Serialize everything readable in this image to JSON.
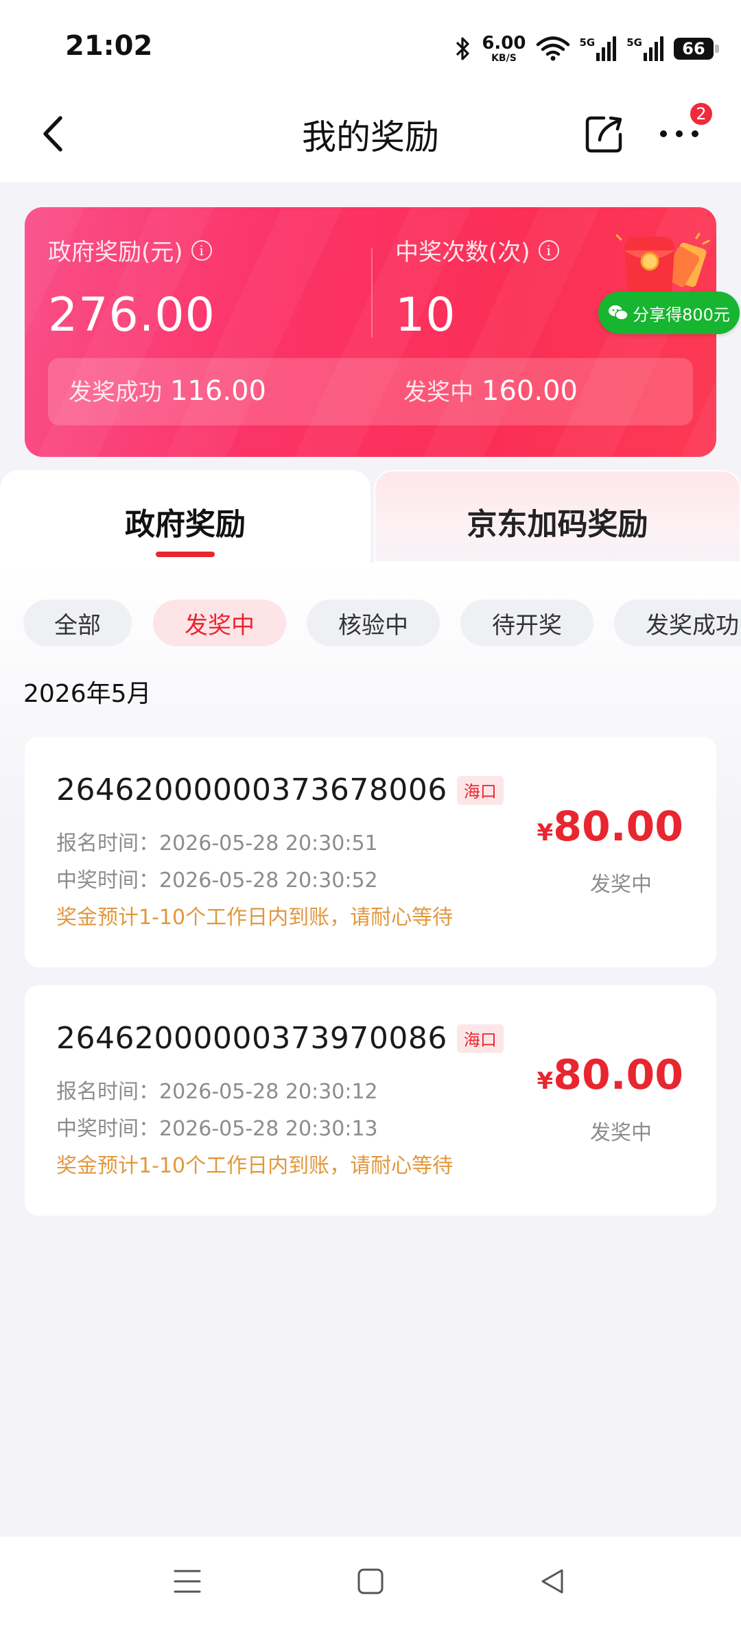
{
  "status_bar": {
    "time": "21:02",
    "net_speed": "6.00",
    "net_unit": "KB/S",
    "signal_1": "5G",
    "signal_2": "5G",
    "battery": "66"
  },
  "header": {
    "title": "我的奖励",
    "notification_count": "2"
  },
  "summary": {
    "gov_reward_label": "政府奖励(元)",
    "gov_reward_value": "276.00",
    "win_count_label": "中奖次数(次)",
    "win_count_value": "10",
    "paid_label": "发奖成功",
    "paid_value": "116.00",
    "pending_label": "发奖中",
    "pending_value": "160.00",
    "share_label": "分享得800元"
  },
  "tabs": [
    {
      "label": "政府奖励",
      "active": true
    },
    {
      "label": "京东加码奖励",
      "active": false
    }
  ],
  "filters": [
    {
      "label": "全部",
      "active": false
    },
    {
      "label": "发奖中",
      "active": true
    },
    {
      "label": "核验中",
      "active": false
    },
    {
      "label": "待开奖",
      "active": false
    },
    {
      "label": "发奖成功",
      "active": false
    }
  ],
  "month_label": "2026年5月",
  "rewards": [
    {
      "id": "264620000003736780​06",
      "city": "海口",
      "signup_time": "报名时间：2026-05-28 20:30:51",
      "win_time": "中奖时间：2026-05-28 20:30:52",
      "note": "奖金预计1-10个工作日内到账，请耐心等待",
      "currency": "¥",
      "amount": "80.00",
      "status": "发奖中"
    },
    {
      "id": "26462000000373970086",
      "city": "海口",
      "signup_time": "报名时间：2026-05-28 20:30:12",
      "win_time": "中奖时间：2026-05-28 20:30:13",
      "note": "奖金预计1-10个工作日内到账，请耐心等待",
      "currency": "¥",
      "amount": "80.00",
      "status": "发奖中"
    }
  ],
  "colors": {
    "accent": "#e8262f",
    "card_gradient_start": "#fa4f8a",
    "card_gradient_end": "#fc3a55",
    "note": "#e2973b",
    "share_green": "#17b530"
  }
}
